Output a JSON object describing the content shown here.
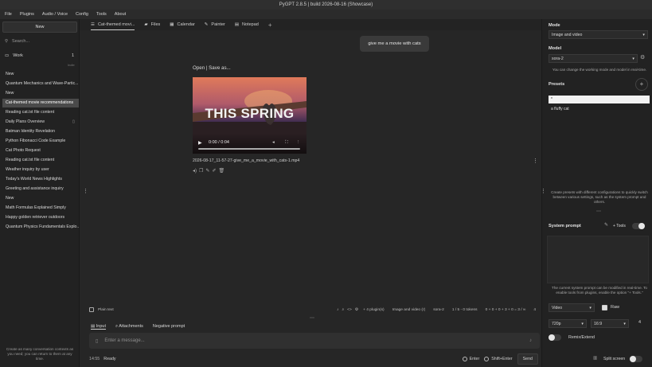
{
  "window": {
    "title": "PyGPT 2.8.5 | build 2026-08-16 (Showcase)"
  },
  "menu": [
    "File",
    "Plugins",
    "Audio / Voice",
    "Config",
    "Tools",
    "About"
  ],
  "sidebar": {
    "new_label": "New",
    "search_placeholder": "Search...",
    "group": {
      "name": "Work",
      "count": "1"
    },
    "indicator": "Indie",
    "items": [
      "New",
      "Quantum Mechanics and Wave-Partic...",
      "New",
      "Cat-themed movie recommendations",
      "Reading cat.txt file content",
      "Daily Plans Overview",
      "Batman Identity Revelation",
      "Python Fibonacci Code Example",
      "Cat Photo Request",
      "Reading cat.txt file content",
      "Weather inquiry by user",
      "Today's World News Highlights",
      "Greeting and assistance inquiry",
      "New",
      "Math Formulas Explained Simply",
      "Happy golden retriever outdoors",
      "Quantum Physics Fundamentals Explo..."
    ],
    "help": "Create as many conversation contexts as you need; you can return to them at any time."
  },
  "tabs": [
    "Cat-themed movi...",
    "Files",
    "Calendar",
    "Painter",
    "Notepad"
  ],
  "chat": {
    "user_message": "give me a movie with cats",
    "output_header": "Open | Save as...",
    "video_caption": "THIS SPRING",
    "video_time": "0:00 / 0:04",
    "file_name": "2026-08-17_11-57-27-give_me_a_movie_with_cats-1.mp4"
  },
  "status": {
    "plain_text": "Plain text",
    "plugins": "+ 4 plugin(s)",
    "mode": "Image and video (r)",
    "model": "sora-2",
    "tokens": "1 / 5 - 0 tokens",
    "counts": "0 + 0 + 0 + 3 + 0 = 3 / ∞",
    "ctx": "4"
  },
  "input": {
    "tabs": [
      "Input",
      "Attachments",
      "Negative prompt"
    ],
    "placeholder": "Enter a message...",
    "time": "14:55",
    "status": "Ready",
    "enter_label": "Enter",
    "shift_enter_label": "Shift+Enter",
    "send_label": "Send"
  },
  "right": {
    "mode_label": "Mode",
    "mode_value": "Image and video",
    "model_label": "Model",
    "model_value": "sora-2",
    "model_help": "You can change the working mode and model in real-time.",
    "presets_label": "Presets",
    "presets": [
      "*",
      "a fluffy cat"
    ],
    "presets_help": "Create presets with different configurations to quickly switch between various settings, such as the system prompt and others.",
    "system_prompt_label": "System prompt",
    "tools_label": "+ Tools",
    "system_help": "The current system prompt can be modified in real-time. To enable tools from plugins, enable the option \"+ Tools.\"",
    "media_type": "Video",
    "raw_label": "Raw",
    "resolution": "720p",
    "aspect": "16:9",
    "duration": "4",
    "remix_label": "Remix/Extend",
    "split_label": "Split screen"
  }
}
